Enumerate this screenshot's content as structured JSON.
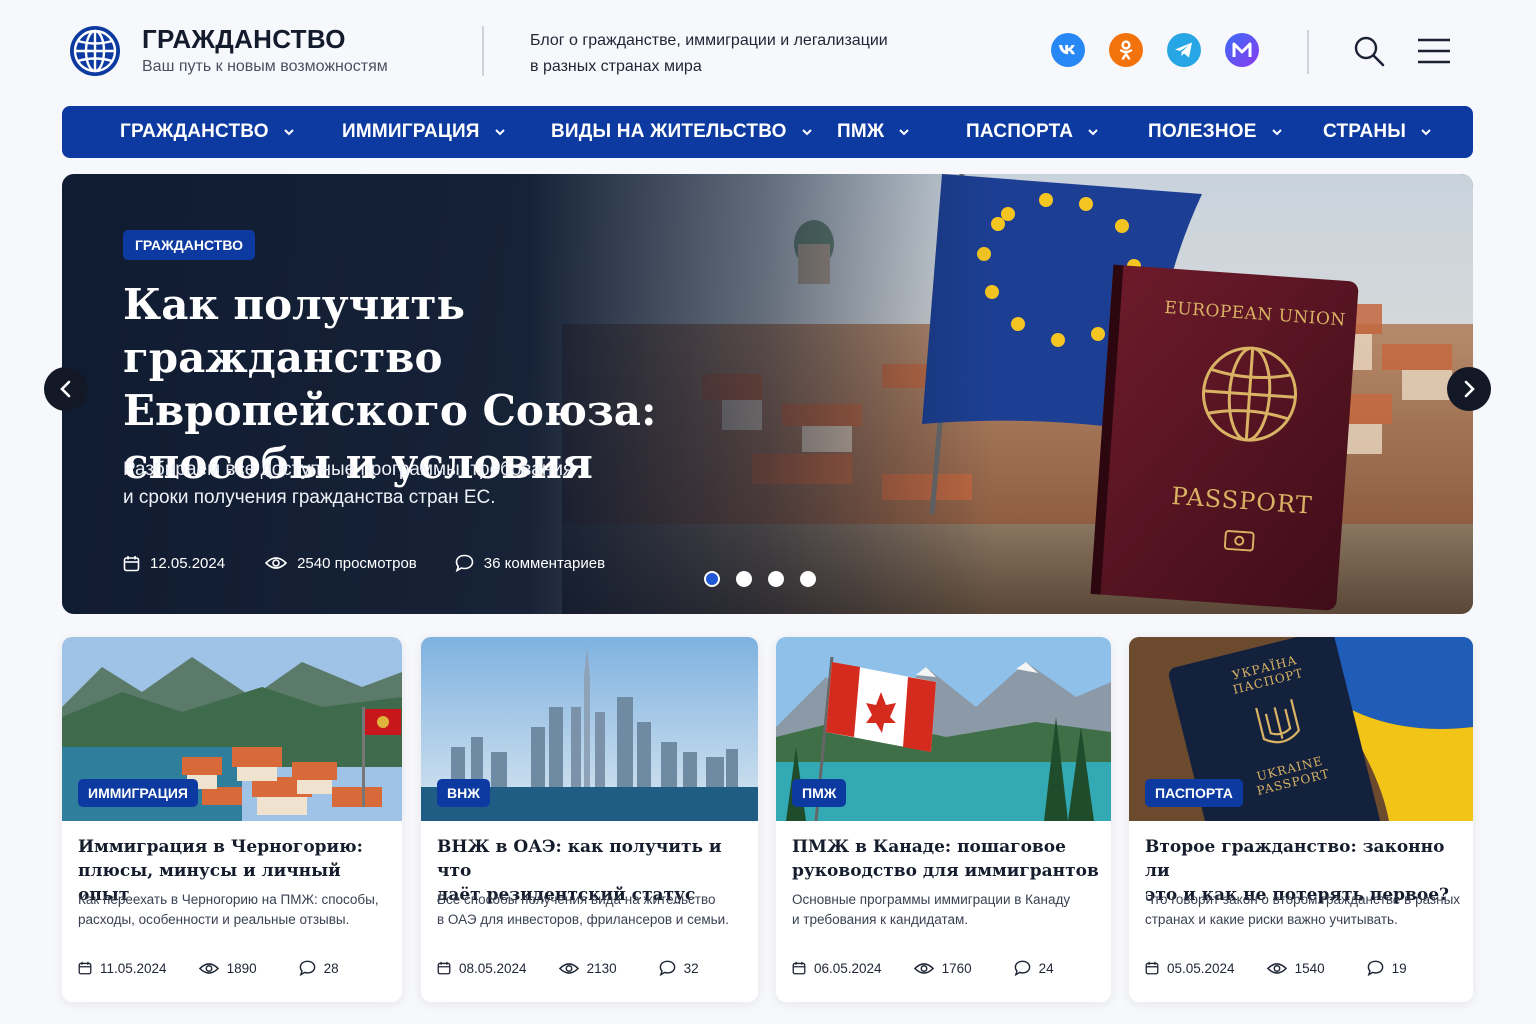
{
  "header": {
    "title": "ГРАЖДАНСТВО",
    "tagline": "Ваш путь к новым возможностям",
    "description_line1": "Блог о гражданстве, иммиграции и легализации",
    "description_line2": "в разных странах мира",
    "socials": [
      {
        "name": "vk-icon",
        "glyph": "vk"
      },
      {
        "name": "ok-icon",
        "glyph": "ok"
      },
      {
        "name": "telegram-icon",
        "glyph": "tg"
      },
      {
        "name": "max-icon",
        "glyph": "M"
      }
    ]
  },
  "nav": {
    "items": [
      {
        "label": "ГРАЖДАНСТВО"
      },
      {
        "label": "ИММИГРАЦИЯ"
      },
      {
        "label": "ВИДЫ НА ЖИТЕЛЬСТВО"
      },
      {
        "label": "ПМЖ"
      },
      {
        "label": "ПАСПОРТА"
      },
      {
        "label": "ПОЛЕЗНОЕ"
      },
      {
        "label": "СТРАНЫ"
      }
    ]
  },
  "hero": {
    "tag": "ГРАЖДАНСТВО",
    "title_line1": "Как получить гражданство",
    "title_line2": "Европейского Союза:",
    "title_line3": "способы и условия",
    "subtitle_line1": "Разбираем все доступные программы, требования",
    "subtitle_line2": "и сроки получения гражданства стран ЕС.",
    "date": "12.05.2024",
    "views": "2540 просмотров",
    "comments": "36 комментариев",
    "passport_top": "EUROPEAN UNION",
    "passport_bottom": "PASSPORT",
    "slides_total": 4,
    "slide_active": 1
  },
  "cards": [
    {
      "tag": "ИММИГРАЦИЯ",
      "title_line1": "Иммиграция в Черногорию:",
      "title_line2": "плюсы, минусы и личный опыт",
      "desc_line1": "Как переехать в Черногорию на ПМЖ: способы,",
      "desc_line2": "расходы, особенности и реальные отзывы.",
      "date": "11.05.2024",
      "views": "1890",
      "comments": "28"
    },
    {
      "tag": "ВНЖ",
      "title_line1": "ВНЖ в ОАЭ: как получить и что",
      "title_line2": "даёт резидентский статус",
      "desc_line1": "Все способы получения вида на жительство",
      "desc_line2": "в ОАЭ для инвесторов, фрилансеров и семьи.",
      "date": "08.05.2024",
      "views": "2130",
      "comments": "32"
    },
    {
      "tag": "ПМЖ",
      "title_line1": "ПМЖ в Канаде: пошаговое",
      "title_line2": "руководство для иммигрантов",
      "desc_line1": "Основные программы иммиграции в Канаду",
      "desc_line2": "и требования к кандидатам.",
      "date": "06.05.2024",
      "views": "1760",
      "comments": "24"
    },
    {
      "tag": "ПАСПОРТА",
      "title_line1": "Второе гражданство: законно ли",
      "title_line2": "это и как не потерять первое?",
      "desc_line1": "Что говорит закон о втором гражданстве в разных",
      "desc_line2": "странах и какие риски важно учитывать.",
      "date": "05.05.2024",
      "views": "1540",
      "comments": "19",
      "passport_top": "УКРАЇНА ПАСПОРТ",
      "passport_bottom": "UKRAINE PASSPORT"
    }
  ],
  "colors": {
    "brand": "#0d3aa0",
    "dark_hero": "#0f1b2f",
    "vk": "#2787f5",
    "ok": "#f2720c",
    "telegram": "#27a6e5"
  }
}
